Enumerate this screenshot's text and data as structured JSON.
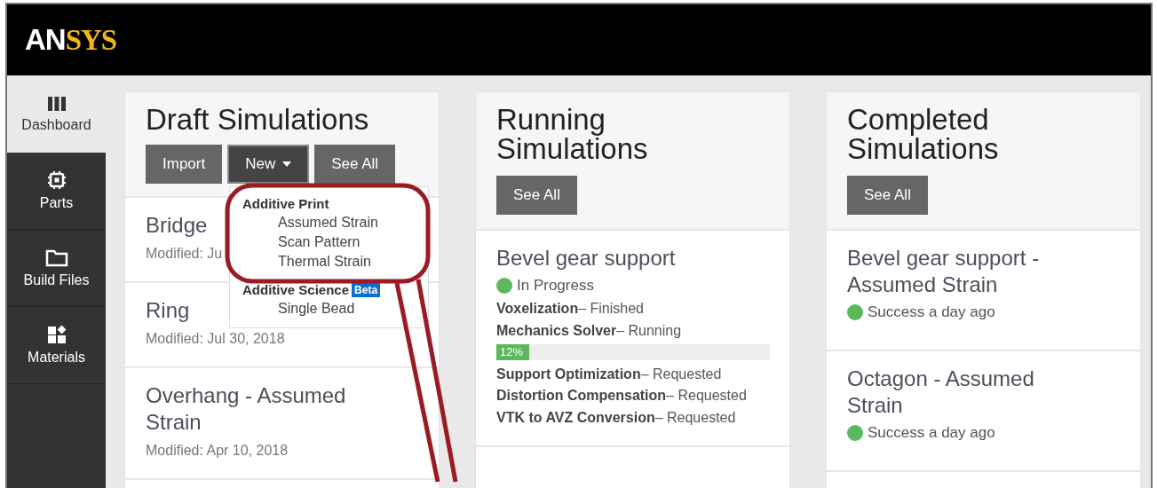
{
  "logo": {
    "part_1": "AN",
    "part_2": "SYS"
  },
  "sidebar": {
    "items": [
      {
        "label": "Dashboard",
        "kind": "columns",
        "selected": true
      },
      {
        "label": "Parts",
        "kind": "chip",
        "selected": false
      },
      {
        "label": "Build Files",
        "kind": "folder",
        "selected": false
      },
      {
        "label": "Materials",
        "kind": "blocks",
        "selected": false
      }
    ]
  },
  "columns": [
    {
      "kind": "draft",
      "title": "Draft Simulations",
      "buttons": [
        {
          "label": "Import",
          "kind": "plain",
          "expanded": false
        },
        {
          "label": "New",
          "kind": "dropdown",
          "expanded": true
        },
        {
          "label": "See All",
          "kind": "plain",
          "expanded": false
        }
      ],
      "cards": [
        {
          "title": "Bridge",
          "subtitle": "Modified: Ju"
        },
        {
          "title": "Ring",
          "subtitle": "Modified: Jul 30, 2018"
        },
        {
          "title": "Overhang - Assumed Strain",
          "subtitle": "Modified: Apr 10, 2018"
        }
      ]
    },
    {
      "kind": "running",
      "title": "Running Simulations",
      "buttons": [
        {
          "label": "See All",
          "kind": "plain",
          "expanded": false
        }
      ],
      "cards": [
        {
          "title": "Bevel gear support",
          "status": "In Progress",
          "color": "#5cb85c",
          "steps": [
            {
              "kind": "text",
              "name": "Voxelization",
              "state": "– Finished"
            },
            {
              "kind": "text",
              "name": "Mechanics Solver",
              "state": "– Running"
            },
            {
              "kind": "progress",
              "level": 0.12,
              "reading": "12%"
            },
            {
              "kind": "text",
              "name": "Support Optimization",
              "state": "– Requested"
            },
            {
              "kind": "text",
              "name": "Distortion Compensation",
              "state": "– Requested"
            },
            {
              "kind": "text",
              "name": "VTK to AVZ Conversion",
              "state": "– Requested"
            }
          ]
        }
      ]
    },
    {
      "kind": "completed",
      "title": "Completed Simulations",
      "buttons": [
        {
          "label": "See All",
          "kind": "plain",
          "expanded": false
        }
      ],
      "cards": [
        {
          "title": "Bevel gear support - Assumed Strain",
          "status": "Success a day ago",
          "color": "#5cb85c"
        },
        {
          "title": "Octagon - Assumed Strain",
          "status": "Success a day ago",
          "color": "#5cb85c"
        }
      ]
    }
  ],
  "new_menu": {
    "groups": [
      {
        "heading": "Additive Print",
        "items": [
          "Assumed Strain",
          "Scan Pattern",
          "Thermal Strain"
        ]
      },
      {
        "heading": "Additive Science",
        "badge": "Beta",
        "items": [
          "Single Bead"
        ]
      }
    ]
  }
}
